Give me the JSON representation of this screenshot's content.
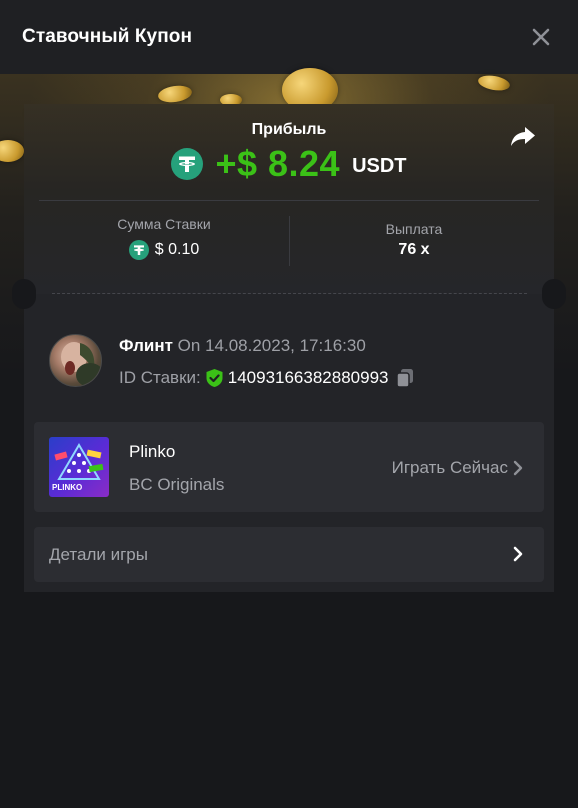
{
  "header": {
    "title": "Ставочный Купон",
    "close_icon": "close-icon"
  },
  "profit": {
    "label": "Прибыль",
    "value": "+$ 8.24",
    "currency": "USDT",
    "currency_icon": "tether-icon",
    "share_icon": "share-icon",
    "color": "#3bc117"
  },
  "stats": {
    "bet_amount_label": "Сумма Ставки",
    "bet_amount_value": "$ 0.10",
    "payout_label": "Выплата",
    "payout_value": "76 x"
  },
  "user": {
    "name": "Флинт",
    "date": "On 14.08.2023, 17:16:30",
    "bet_id_label": "ID Ставки:",
    "bet_id": "14093166382880993",
    "verified_icon": "shield-check-icon",
    "copy_icon": "copy-icon"
  },
  "game": {
    "name": "Plinko",
    "provider": "BC Originals",
    "play_label": "Играть Сейчас",
    "thumbnail_label": "PLINKO"
  },
  "details": {
    "label": "Детали игры"
  }
}
